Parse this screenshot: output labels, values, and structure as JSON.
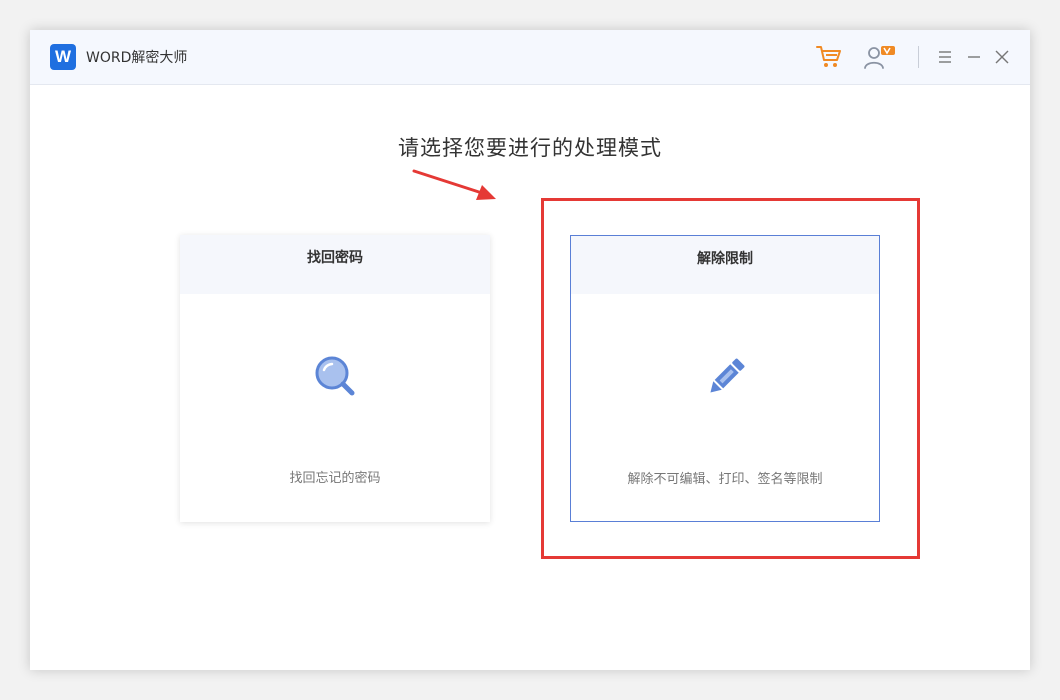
{
  "app": {
    "logo_letter": "W",
    "title": "WORD解密大师"
  },
  "titlebar": {
    "icons": [
      "cart-icon",
      "user-vip-icon",
      "menu-icon",
      "minimize-icon",
      "close-icon"
    ],
    "accent_color": "#f08a24"
  },
  "main": {
    "headline": "请选择您要进行的处理模式"
  },
  "cards": [
    {
      "title": "找回密码",
      "icon": "magnifier-icon",
      "description": "找回忘记的密码"
    },
    {
      "title": "解除限制",
      "icon": "pencil-icon",
      "description": "解除不可编辑、打印、签名等限制"
    }
  ],
  "annotation": {
    "highlight_color": "#e53935",
    "arrow_color": "#e53935"
  }
}
